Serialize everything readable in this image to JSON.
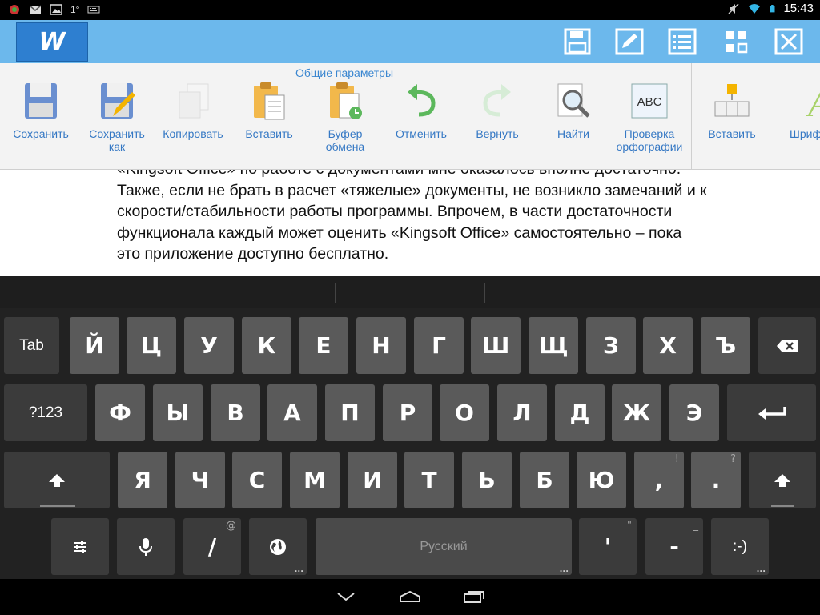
{
  "status_bar": {
    "time": "15:43",
    "left_icons": [
      "app-notification-icon",
      "gmail-icon",
      "image-icon",
      "temperature-icon",
      "keyboard-icon"
    ],
    "temperature": "1°",
    "right_icons": [
      "mute-icon",
      "wifi-icon",
      "battery-icon"
    ]
  },
  "header": {
    "logo": "W",
    "buttons": [
      "save-icon",
      "edit-icon",
      "list-view-icon",
      "grid-icon",
      "close-icon"
    ]
  },
  "ribbon": {
    "title": "Общие параметры",
    "items": [
      {
        "label": "Сохранить",
        "icon": "save-icon",
        "enabled": true
      },
      {
        "label": "Сохранить как",
        "icon": "save-as-icon",
        "enabled": true
      },
      {
        "label": "Копировать",
        "icon": "copy-icon",
        "enabled": false
      },
      {
        "label": "Вставить",
        "icon": "paste-icon",
        "enabled": true
      },
      {
        "label": "Буфер обмена",
        "icon": "clipboard-icon",
        "enabled": true
      },
      {
        "label": "Отменить",
        "icon": "undo-icon",
        "enabled": true
      },
      {
        "label": "Вернуть",
        "icon": "redo-icon",
        "enabled": false
      },
      {
        "label": "Найти",
        "icon": "find-icon",
        "enabled": true
      },
      {
        "label": "Проверка орфографии",
        "icon": "spellcheck-icon",
        "enabled": true
      },
      {
        "label": "Вставить",
        "icon": "insert-icon",
        "enabled": true
      },
      {
        "label": "Шриф",
        "icon": "font-icon",
        "enabled": true
      }
    ]
  },
  "document": {
    "lines": [
      "«Kingsoft Office» по работе с документами мне оказалось вполне достаточно.",
      "Также, если не брать в расчет «тяжелые» документы, не возникло замечаний и к",
      "скорости/стабильности работы программы. Впрочем, в части достаточности",
      "функционала каждый может оценить «Kingsoft Office» самостоятельно – пока",
      "это приложение доступно бесплатно."
    ]
  },
  "keyboard": {
    "row1": [
      "Й",
      "Ц",
      "У",
      "К",
      "Е",
      "Н",
      "Г",
      "Ш",
      "Щ",
      "З",
      "Х",
      "Ъ"
    ],
    "row2": [
      "Ф",
      "Ы",
      "В",
      "А",
      "П",
      "Р",
      "О",
      "Л",
      "Д",
      "Ж",
      "Э"
    ],
    "row3": [
      "Я",
      "Ч",
      "С",
      "М",
      "И",
      "Т",
      "Ь",
      "Б",
      "Ю",
      ",",
      "."
    ],
    "row3_hints": [
      "",
      "",
      "",
      "",
      "",
      "",
      "",
      "",
      "",
      "!",
      "?"
    ],
    "tab": "Tab",
    "symbols": "?123",
    "space_label": "Русский",
    "slash": "/",
    "slash_hint": "@",
    "apostrophe": "'",
    "apostrophe_hint": "\"",
    "dash": "-",
    "dash_hint": "_",
    "smiley": ":-)"
  },
  "nav_bar": {
    "buttons": [
      "back-icon",
      "home-icon",
      "recent-apps-icon"
    ]
  }
}
